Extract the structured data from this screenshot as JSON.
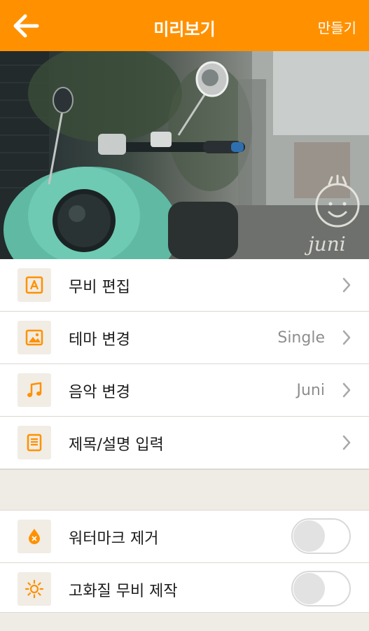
{
  "header": {
    "title": "미리보기",
    "make_label": "만들기",
    "back_icon": "arrow-left-icon",
    "accent_color": "#ff9100"
  },
  "preview": {
    "watermark_text": "juni"
  },
  "menu": [
    {
      "label": "무비 편집",
      "value": "",
      "icon": "text-a-icon"
    },
    {
      "label": "테마 변경",
      "value": "Single",
      "icon": "image-icon"
    },
    {
      "label": "음악 변경",
      "value": "Juni",
      "icon": "music-note-icon"
    },
    {
      "label": "제목/설명 입력",
      "value": "",
      "icon": "document-icon"
    }
  ],
  "options": [
    {
      "label": "워터마크 제거",
      "icon": "watermark-drop-icon",
      "enabled": false
    },
    {
      "label": "고화질 무비 제작",
      "icon": "sun-icon",
      "enabled": false
    }
  ]
}
